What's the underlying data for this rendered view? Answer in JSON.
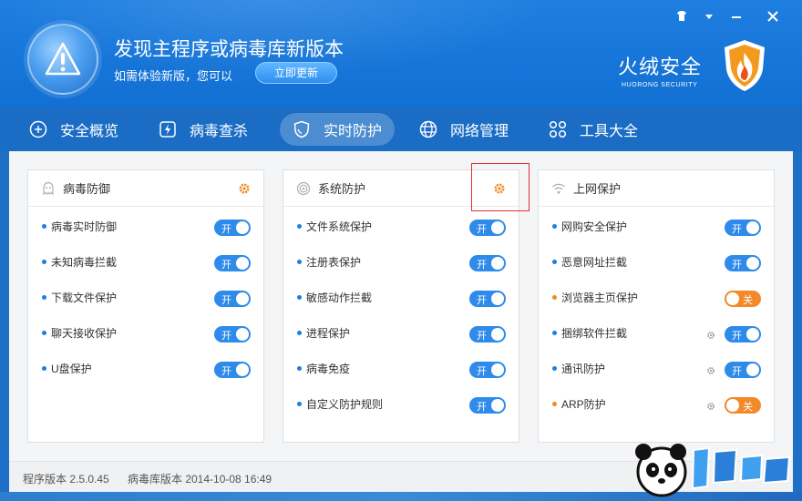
{
  "header": {
    "title": "发现主程序或病毒库新版本",
    "subtitle": "如需体验新版，您可以",
    "update_button": "立即更新",
    "brand_name": "火绒安全",
    "brand_sub": "HUORONG SECURITY",
    "window_controls": [
      "shirt-icon",
      "menu-icon",
      "minimize-icon",
      "close-icon"
    ]
  },
  "nav": {
    "items": [
      {
        "label": "安全概览",
        "icon": "plus-circle-icon"
      },
      {
        "label": "病毒查杀",
        "icon": "scan-icon"
      },
      {
        "label": "实时防护",
        "icon": "shield-icon",
        "active": true
      },
      {
        "label": "网络管理",
        "icon": "globe-icon"
      },
      {
        "label": "工具大全",
        "icon": "tools-icon"
      }
    ]
  },
  "panels": [
    {
      "title": "病毒防御",
      "rows": [
        {
          "label": "病毒实时防御",
          "state": "开"
        },
        {
          "label": "未知病毒拦截",
          "state": "开"
        },
        {
          "label": "下载文件保护",
          "state": "开"
        },
        {
          "label": "聊天接收保护",
          "state": "开"
        },
        {
          "label": "U盘保护",
          "state": "开"
        }
      ]
    },
    {
      "title": "系统防护",
      "rows": [
        {
          "label": "文件系统保护",
          "state": "开"
        },
        {
          "label": "注册表保护",
          "state": "开"
        },
        {
          "label": "敏感动作拦截",
          "state": "开"
        },
        {
          "label": "进程保护",
          "state": "开"
        },
        {
          "label": "病毒免疫",
          "state": "开"
        },
        {
          "label": "自定义防护规则",
          "state": "开"
        }
      ]
    },
    {
      "title": "上网保护",
      "rows": [
        {
          "label": "网购安全保护",
          "state": "开"
        },
        {
          "label": "恶意网址拦截",
          "state": "开"
        },
        {
          "label": "浏览器主页保护",
          "state": "关"
        },
        {
          "label": "捆绑软件拦截",
          "state": "开"
        },
        {
          "label": "通讯防护",
          "state": "开"
        },
        {
          "label": "ARP防护",
          "state": "关"
        }
      ]
    }
  ],
  "footer": {
    "program_version": "程序版本 2.5.0.45",
    "virus_db_version": "病毒库版本 2014-10-08 16:49"
  },
  "colors": {
    "header_blue": "#1675d8",
    "toggle_on": "#2f8bea",
    "toggle_off": "#f28a2a",
    "gear_orange": "#f08a24"
  }
}
